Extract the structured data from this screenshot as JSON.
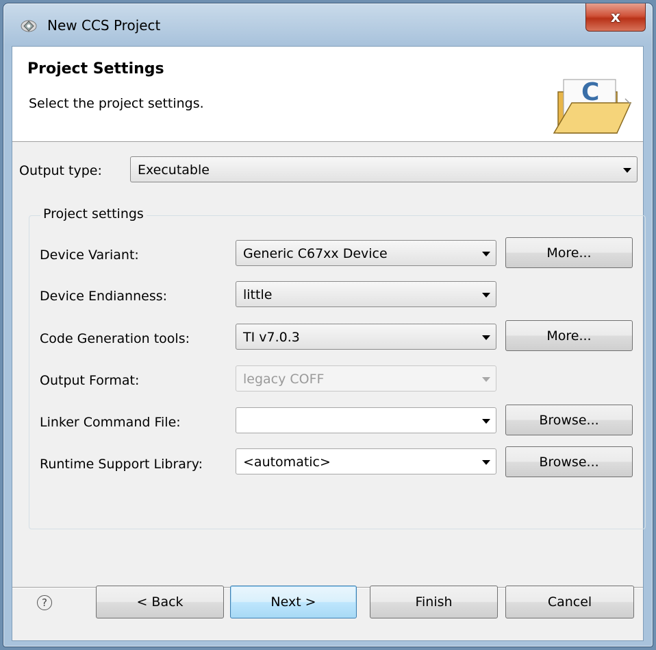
{
  "window": {
    "title": "New CCS Project",
    "close_glyph": "x"
  },
  "banner": {
    "title": "Project Settings",
    "description": "Select the project settings.",
    "icon": "folder-c-icon"
  },
  "output_type": {
    "label": "Output type:",
    "value": "Executable"
  },
  "project_settings": {
    "group_title": "Project settings",
    "device_variant": {
      "label": "Device Variant:",
      "value": "Generic C67xx Device",
      "button": "More..."
    },
    "device_endianness": {
      "label": "Device Endianness:",
      "value": "little"
    },
    "codegen_tools": {
      "label": "Code Generation tools:",
      "value": "TI v7.0.3",
      "button": "More..."
    },
    "output_format": {
      "label": "Output Format:",
      "value": "legacy COFF",
      "disabled": true
    },
    "linker_command_file": {
      "label": "Linker Command File:",
      "value": "",
      "button": "Browse..."
    },
    "runtime_support_library": {
      "label": "Runtime Support Library:",
      "value": "<automatic>",
      "button": "Browse..."
    }
  },
  "footer": {
    "help_glyph": "?",
    "back": "< Back",
    "next": "Next >",
    "finish": "Finish",
    "cancel": "Cancel"
  },
  "colors": {
    "window_frame": "#a9c3dc",
    "close_button": "#c9462c",
    "default_button_border": "#3c7fb1"
  }
}
